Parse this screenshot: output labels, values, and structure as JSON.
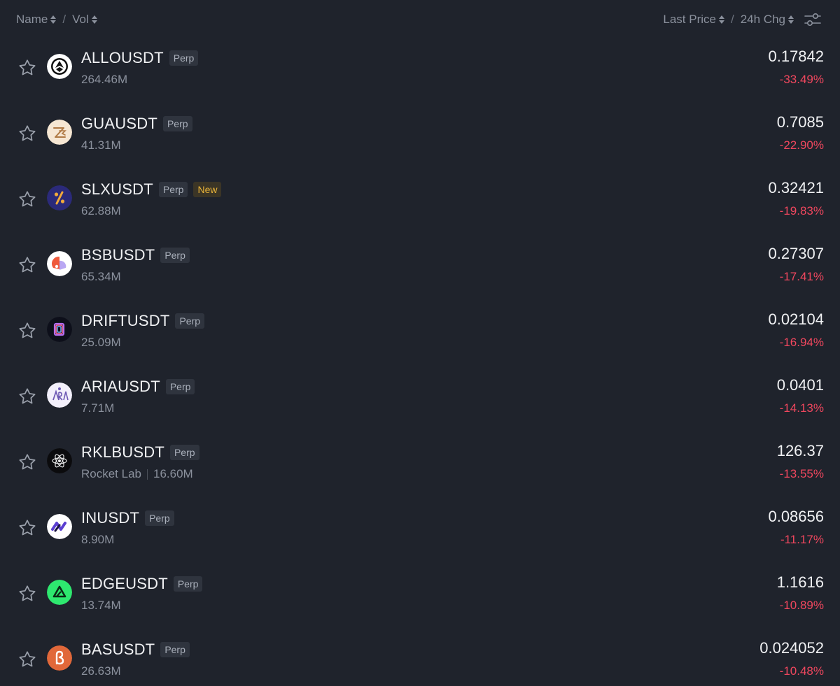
{
  "header": {
    "name_label": "Name",
    "vol_label": "Vol",
    "separator": "/",
    "last_price_label": "Last Price",
    "change_label": "24h Chg"
  },
  "colors": {
    "background": "#1f232c",
    "negative": "#f0475e",
    "new_badge": "#e8b339",
    "muted": "#8b919d"
  },
  "rows": [
    {
      "symbol": "ALLOUSDT",
      "tag": "Perp",
      "volume": "264.46M",
      "price": "0.17842",
      "change": "-33.49%",
      "icon": "allo-icon"
    },
    {
      "symbol": "GUAUSDT",
      "tag": "Perp",
      "volume": "41.31M",
      "price": "0.7085",
      "change": "-22.90%",
      "icon": "gua-icon"
    },
    {
      "symbol": "SLXUSDT",
      "tag": "Perp",
      "badge": "New",
      "volume": "62.88M",
      "price": "0.32421",
      "change": "-19.83%",
      "icon": "slx-icon"
    },
    {
      "symbol": "BSBUSDT",
      "tag": "Perp",
      "volume": "65.34M",
      "price": "0.27307",
      "change": "-17.41%",
      "icon": "bsb-icon"
    },
    {
      "symbol": "DRIFTUSDT",
      "tag": "Perp",
      "volume": "25.09M",
      "price": "0.02104",
      "change": "-16.94%",
      "icon": "drift-icon"
    },
    {
      "symbol": "ARIAUSDT",
      "tag": "Perp",
      "volume": "7.71M",
      "price": "0.0401",
      "change": "-14.13%",
      "icon": "aria-icon"
    },
    {
      "symbol": "RKLBUSDT",
      "tag": "Perp",
      "name": "Rocket Lab",
      "volume": "16.60M",
      "price": "126.37",
      "change": "-13.55%",
      "icon": "rklb-icon"
    },
    {
      "symbol": "INUSDT",
      "tag": "Perp",
      "volume": "8.90M",
      "price": "0.08656",
      "change": "-11.17%",
      "icon": "in-icon"
    },
    {
      "symbol": "EDGEUSDT",
      "tag": "Perp",
      "volume": "13.74M",
      "price": "1.1616",
      "change": "-10.89%",
      "icon": "edge-icon"
    },
    {
      "symbol": "BASUSDT",
      "tag": "Perp",
      "volume": "26.63M",
      "price": "0.024052",
      "change": "-10.48%",
      "icon": "bas-icon"
    }
  ]
}
